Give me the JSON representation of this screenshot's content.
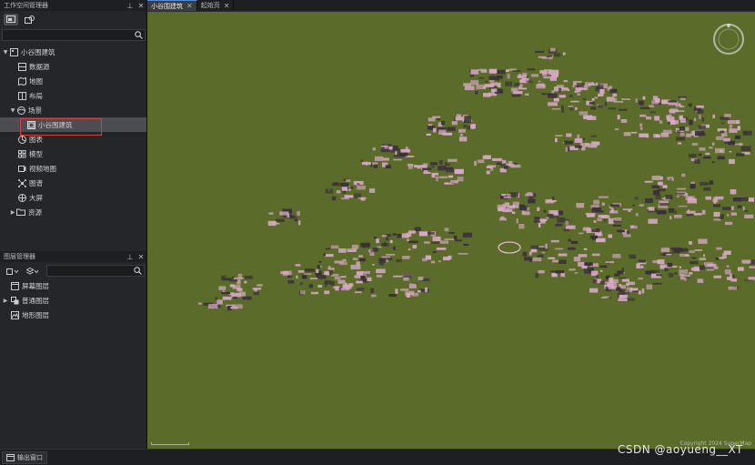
{
  "workspace_panel": {
    "title": "工作空间管理器",
    "pin_glyph": "⊥",
    "close_glyph": "✕",
    "search_placeholder": "",
    "tree": [
      {
        "label": "小谷围建筑",
        "level": 0,
        "expanded": true,
        "icon": "database-icon"
      },
      {
        "label": "数据源",
        "level": 1,
        "icon": "datasource-icon"
      },
      {
        "label": "地图",
        "level": 1,
        "icon": "map-icon"
      },
      {
        "label": "布局",
        "level": 1,
        "icon": "layout-icon"
      },
      {
        "label": "场景",
        "level": 1,
        "expanded": true,
        "icon": "scene-icon"
      },
      {
        "label": "小谷围建筑",
        "level": 2,
        "selected": true,
        "icon": "scene-item-icon"
      },
      {
        "label": "图表",
        "level": 1,
        "icon": "chart-icon"
      },
      {
        "label": "模型",
        "level": 1,
        "icon": "model-icon"
      },
      {
        "label": "视频地图",
        "level": 1,
        "icon": "video-map-icon"
      },
      {
        "label": "图谱",
        "level": 1,
        "icon": "graph-icon"
      },
      {
        "label": "大屏",
        "level": 1,
        "icon": "dashboard-icon"
      },
      {
        "label": "资源",
        "level": 1,
        "collapsed": true,
        "icon": "folder-icon"
      }
    ]
  },
  "layer_panel": {
    "title": "图层管理器",
    "pin_glyph": "⊥",
    "close_glyph": "✕",
    "search_placeholder": "",
    "items": [
      {
        "label": "屏幕图层",
        "icon": "screen-layer-icon"
      },
      {
        "label": "普通图层",
        "icon": "normal-layer-icon",
        "collapsed": true
      },
      {
        "label": "地形图层",
        "icon": "terrain-layer-icon"
      }
    ]
  },
  "tabs": [
    {
      "label": "小谷围建筑",
      "active": true,
      "close": "✕"
    },
    {
      "label": "起始页",
      "active": false,
      "close": "✕"
    }
  ],
  "viewport": {
    "copyright": "Copyright 2024 SuperMap",
    "background_color": "#5a6b2a",
    "building_color": "#d9a8c8"
  },
  "status": {
    "output_window_label": "输出窗口"
  },
  "watermark": "CSDN @aoyueng__XT"
}
